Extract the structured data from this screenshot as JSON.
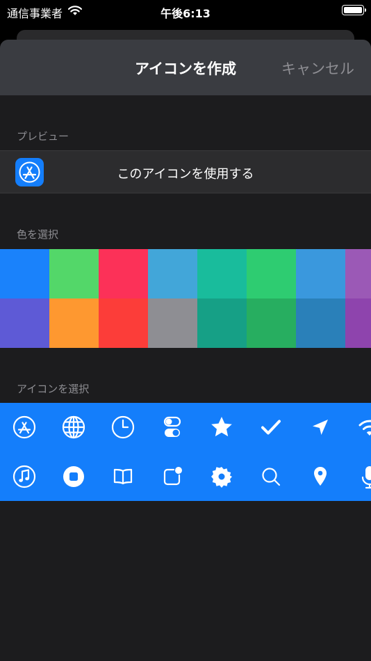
{
  "status_bar": {
    "carrier": "通信事業者",
    "time": "午後6:13"
  },
  "nav": {
    "title": "アイコンを作成",
    "cancel_label": "キャンセル"
  },
  "preview": {
    "header": "プレビュー",
    "use_label": "このアイコンを使用する",
    "icon": "app-store-icon"
  },
  "colors_section": {
    "header": "色を選択",
    "rows": [
      [
        "#1a82fb",
        "#53d769",
        "#fc3158",
        "#42a6d9",
        "#19bc9c",
        "#2ecc71",
        "#3a98dd",
        "#9b59b6"
      ],
      [
        "#5e5ad6",
        "#fe9830",
        "#fc3d39",
        "#8e8e93",
        "#16a086",
        "#27ae60",
        "#2a80b9",
        "#8e44ad"
      ]
    ]
  },
  "icons_section": {
    "header": "アイコンを選択",
    "background": "#147efb",
    "rows": [
      [
        "app-store-icon",
        "globe-icon",
        "clock-icon",
        "toggles-icon",
        "star-icon",
        "checkmark-icon",
        "location-arrow-icon",
        "wifi-icon"
      ],
      [
        "music-note-icon",
        "stop-button-icon",
        "book-icon",
        "notification-badge-icon",
        "gear-icon",
        "search-icon",
        "map-pin-icon",
        "microphone-icon"
      ]
    ]
  }
}
